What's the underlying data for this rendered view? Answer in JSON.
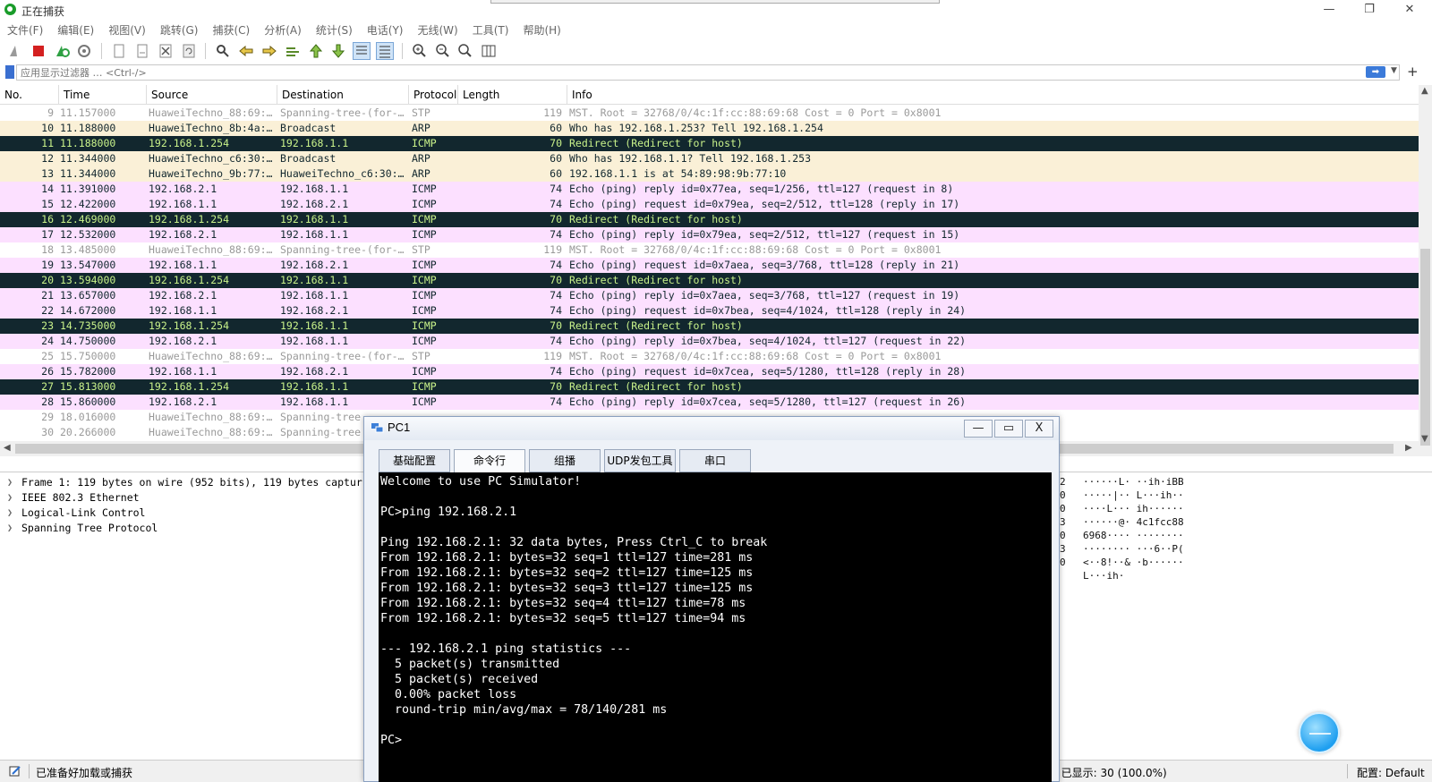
{
  "window": {
    "title": "正在捕获",
    "minimize": "—",
    "maximize": "❐",
    "close": "✕"
  },
  "menu": [
    "文件(F)",
    "编辑(E)",
    "视图(V)",
    "跳转(G)",
    "捕获(C)",
    "分析(A)",
    "统计(S)",
    "电话(Y)",
    "无线(W)",
    "工具(T)",
    "帮助(H)"
  ],
  "toolbar": {
    "icons": [
      "shark-fin-start-icon",
      "stop-capture-icon",
      "restart-capture-icon",
      "capture-options-icon",
      "open-file-icon",
      "save-file-icon",
      "close-file-icon",
      "reload-icon",
      "find-packet-icon",
      "go-back-icon",
      "go-forward-icon",
      "go-to-packet-icon",
      "go-first-icon",
      "go-last-icon",
      "autoscroll-icon",
      "colorize-icon",
      "zoom-in-icon",
      "zoom-out-icon",
      "zoom-normal-icon",
      "resize-columns-icon"
    ]
  },
  "filter": {
    "placeholder": "应用显示过滤器 … <Ctrl-/>",
    "value": "",
    "apply_label": "➡",
    "dropdown": "▼",
    "add": "+"
  },
  "packet_list": {
    "columns": [
      "No.",
      "Time",
      "Source",
      "Destination",
      "Protocol",
      "Length",
      "Info"
    ],
    "rows": [
      {
        "no": "9",
        "time": "11.157000",
        "src": "HuaweiTechno_88:69:…",
        "dst": "Spanning-tree-(for-…",
        "proto": "STP",
        "len": "119",
        "info": "MST. Root = 32768/0/4c:1f:cc:88:69:68  Cost = 0  Port = 0x8001",
        "kind": "stp"
      },
      {
        "no": "10",
        "time": "11.188000",
        "src": "HuaweiTechno_8b:4a:…",
        "dst": "Broadcast",
        "proto": "ARP",
        "len": "60",
        "info": "Who has 192.168.1.253? Tell 192.168.1.254",
        "kind": "arp"
      },
      {
        "no": "11",
        "time": "11.188000",
        "src": "192.168.1.254",
        "dst": "192.168.1.1",
        "proto": "ICMP",
        "len": "70",
        "info": "Redirect              (Redirect for host)",
        "kind": "redirect"
      },
      {
        "no": "12",
        "time": "11.344000",
        "src": "HuaweiTechno_c6:30:…",
        "dst": "Broadcast",
        "proto": "ARP",
        "len": "60",
        "info": "Who has 192.168.1.1? Tell 192.168.1.253",
        "kind": "arp"
      },
      {
        "no": "13",
        "time": "11.344000",
        "src": "HuaweiTechno_9b:77:…",
        "dst": "HuaweiTechno_c6:30:…",
        "proto": "ARP",
        "len": "60",
        "info": "192.168.1.1 is at 54:89:98:9b:77:10",
        "kind": "arp"
      },
      {
        "no": "14",
        "time": "11.391000",
        "src": "192.168.2.1",
        "dst": "192.168.1.1",
        "proto": "ICMP",
        "len": "74",
        "info": "Echo (ping) reply    id=0x77ea, seq=1/256, ttl=127 (request in 8)",
        "kind": "icmp"
      },
      {
        "no": "15",
        "time": "12.422000",
        "src": "192.168.1.1",
        "dst": "192.168.2.1",
        "proto": "ICMP",
        "len": "74",
        "info": "Echo (ping) request  id=0x79ea, seq=2/512, ttl=128 (reply in 17)",
        "kind": "icmp"
      },
      {
        "no": "16",
        "time": "12.469000",
        "src": "192.168.1.254",
        "dst": "192.168.1.1",
        "proto": "ICMP",
        "len": "70",
        "info": "Redirect              (Redirect for host)",
        "kind": "redirect"
      },
      {
        "no": "17",
        "time": "12.532000",
        "src": "192.168.2.1",
        "dst": "192.168.1.1",
        "proto": "ICMP",
        "len": "74",
        "info": "Echo (ping) reply    id=0x79ea, seq=2/512, ttl=127 (request in 15)",
        "kind": "icmp"
      },
      {
        "no": "18",
        "time": "13.485000",
        "src": "HuaweiTechno_88:69:…",
        "dst": "Spanning-tree-(for-…",
        "proto": "STP",
        "len": "119",
        "info": "MST. Root = 32768/0/4c:1f:cc:88:69:68  Cost = 0  Port = 0x8001",
        "kind": "stp"
      },
      {
        "no": "19",
        "time": "13.547000",
        "src": "192.168.1.1",
        "dst": "192.168.2.1",
        "proto": "ICMP",
        "len": "74",
        "info": "Echo (ping) request  id=0x7aea, seq=3/768, ttl=128 (reply in 21)",
        "kind": "icmp"
      },
      {
        "no": "20",
        "time": "13.594000",
        "src": "192.168.1.254",
        "dst": "192.168.1.1",
        "proto": "ICMP",
        "len": "70",
        "info": "Redirect              (Redirect for host)",
        "kind": "redirect"
      },
      {
        "no": "21",
        "time": "13.657000",
        "src": "192.168.2.1",
        "dst": "192.168.1.1",
        "proto": "ICMP",
        "len": "74",
        "info": "Echo (ping) reply    id=0x7aea, seq=3/768, ttl=127 (request in 19)",
        "kind": "icmp"
      },
      {
        "no": "22",
        "time": "14.672000",
        "src": "192.168.1.1",
        "dst": "192.168.2.1",
        "proto": "ICMP",
        "len": "74",
        "info": "Echo (ping) request  id=0x7bea, seq=4/1024, ttl=128 (reply in 24)",
        "kind": "icmp"
      },
      {
        "no": "23",
        "time": "14.735000",
        "src": "192.168.1.254",
        "dst": "192.168.1.1",
        "proto": "ICMP",
        "len": "70",
        "info": "Redirect              (Redirect for host)",
        "kind": "redirect"
      },
      {
        "no": "24",
        "time": "14.750000",
        "src": "192.168.2.1",
        "dst": "192.168.1.1",
        "proto": "ICMP",
        "len": "74",
        "info": "Echo (ping) reply    id=0x7bea, seq=4/1024, ttl=127 (request in 22)",
        "kind": "icmp"
      },
      {
        "no": "25",
        "time": "15.750000",
        "src": "HuaweiTechno_88:69:…",
        "dst": "Spanning-tree-(for-…",
        "proto": "STP",
        "len": "119",
        "info": "MST. Root = 32768/0/4c:1f:cc:88:69:68  Cost = 0  Port = 0x8001",
        "kind": "stp"
      },
      {
        "no": "26",
        "time": "15.782000",
        "src": "192.168.1.1",
        "dst": "192.168.2.1",
        "proto": "ICMP",
        "len": "74",
        "info": "Echo (ping) request  id=0x7cea, seq=5/1280, ttl=128 (reply in 28)",
        "kind": "icmp"
      },
      {
        "no": "27",
        "time": "15.813000",
        "src": "192.168.1.254",
        "dst": "192.168.1.1",
        "proto": "ICMP",
        "len": "70",
        "info": "Redirect              (Redirect for host)",
        "kind": "redirect"
      },
      {
        "no": "28",
        "time": "15.860000",
        "src": "192.168.2.1",
        "dst": "192.168.1.1",
        "proto": "ICMP",
        "len": "74",
        "info": "Echo (ping) reply    id=0x7cea, seq=5/1280, ttl=127 (request in 26)",
        "kind": "icmp"
      },
      {
        "no": "29",
        "time": "18.016000",
        "src": "HuaweiTechno_88:69:…",
        "dst": "Spanning-tree",
        "proto": "",
        "len": "",
        "info": "",
        "kind": "stp"
      },
      {
        "no": "30",
        "time": "20.266000",
        "src": "HuaweiTechno_88:69:…",
        "dst": "Spanning-tree",
        "proto": "",
        "len": "",
        "info": "",
        "kind": "stp"
      }
    ]
  },
  "details": [
    "Frame 1: 119 bytes on wire (952 bits), 119 bytes captur",
    "IEEE 802.3 Ethernet",
    "Logical-Link Control",
    "Spanning Tree Protocol"
  ],
  "bytes": {
    "offsets": [
      "2",
      "0",
      "0",
      "3",
      "0",
      "3",
      "0",
      ""
    ],
    "ascii": [
      "······L· ··ih·iBB",
      "·····|·· L···ih··",
      "····L··· ih······",
      "······@· 4c1fcc88",
      "6968···· ········",
      "········ ···6··P(",
      "<··8!··& ·b······",
      "L···ih·"
    ]
  },
  "status": {
    "ready": "已准备好加载或捕获",
    "shown": "· 已显示: 30 (100.0%)",
    "profile": "配置: Default"
  },
  "pc1": {
    "title": "PC1",
    "min": "—",
    "max": "▭",
    "close": "X",
    "tabs": [
      "基础配置",
      "命令行",
      "组播",
      "UDP发包工具",
      "串口"
    ],
    "active_tab": 1,
    "console": [
      "Welcome to use PC Simulator!",
      "",
      "PC>ping 192.168.2.1",
      "",
      "Ping 192.168.2.1: 32 data bytes, Press Ctrl_C to break",
      "From 192.168.2.1: bytes=32 seq=1 ttl=127 time=281 ms",
      "From 192.168.2.1: bytes=32 seq=2 ttl=127 time=125 ms",
      "From 192.168.2.1: bytes=32 seq=3 ttl=127 time=125 ms",
      "From 192.168.2.1: bytes=32 seq=4 ttl=127 time=78 ms",
      "From 192.168.2.1: bytes=32 seq=5 ttl=127 time=94 ms",
      "",
      "--- 192.168.2.1 ping statistics ---",
      "  5 packet(s) transmitted",
      "  5 packet(s) received",
      "  0.00% packet loss",
      "  round-trip min/avg/max = 78/140/281 ms",
      "",
      "PC>"
    ]
  }
}
